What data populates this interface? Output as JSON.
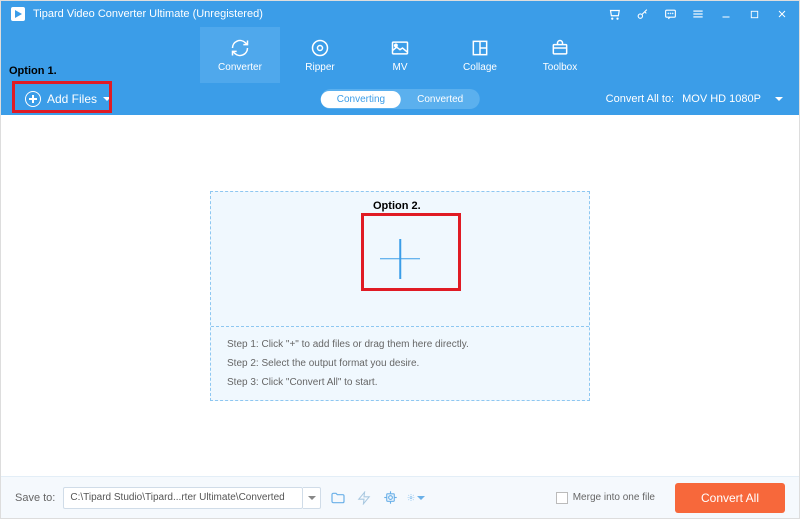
{
  "titlebar": {
    "app_name": "Tipard Video Converter Ultimate (Unregistered)"
  },
  "nav": {
    "converter": "Converter",
    "ripper": "Ripper",
    "mv": "MV",
    "collage": "Collage",
    "toolbox": "Toolbox"
  },
  "subbar": {
    "add_files": "Add Files",
    "converting": "Converting",
    "converted": "Converted",
    "convert_all_to": "Convert All to:",
    "format": "MOV HD 1080P"
  },
  "dropzone": {
    "step1": "Step 1: Click \"+\" to add files or drag them here directly.",
    "step2": "Step 2: Select the output format you desire.",
    "step3": "Step 3: Click \"Convert All\" to start."
  },
  "footer": {
    "save_to": "Save to:",
    "path": "C:\\Tipard Studio\\Tipard...rter Ultimate\\Converted",
    "merge": "Merge into one file",
    "convert_all": "Convert All"
  },
  "annotations": {
    "option1": "Option 1.",
    "option2": "Option 2."
  }
}
